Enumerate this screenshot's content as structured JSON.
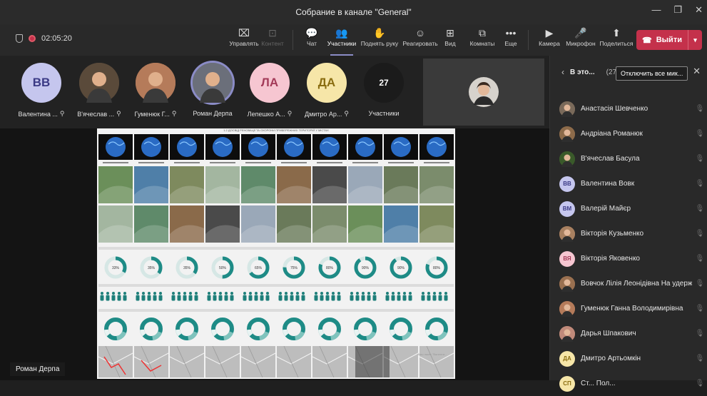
{
  "window": {
    "title": "Собрание в канале \"General\"",
    "controls": [
      "—",
      "❐",
      "✕"
    ]
  },
  "meeting": {
    "elapsed": "02:05:20"
  },
  "toolbar": {
    "items": [
      {
        "label": "Управлять",
        "icon": "share-control-icon",
        "glyph": "⌧",
        "state": "normal"
      },
      {
        "label": "Контент",
        "icon": "content-icon",
        "glyph": "⊡",
        "state": "disabled"
      },
      {
        "label": "Чат",
        "icon": "chat-icon",
        "glyph": "💬",
        "state": "normal"
      },
      {
        "label": "Участники",
        "icon": "participants-icon",
        "glyph": "👥",
        "state": "active"
      },
      {
        "label": "Поднять руку",
        "icon": "raise-hand-icon",
        "glyph": "✋",
        "state": "normal"
      },
      {
        "label": "Реагировать",
        "icon": "react-icon",
        "glyph": "☺",
        "state": "normal"
      },
      {
        "label": "Вид",
        "icon": "view-icon",
        "glyph": "⊞",
        "state": "normal"
      },
      {
        "label": "Комнаты",
        "icon": "rooms-icon",
        "glyph": "⧉",
        "state": "normal"
      },
      {
        "label": "Еще",
        "icon": "more-icon",
        "glyph": "•••",
        "state": "normal"
      },
      {
        "label": "Камера",
        "icon": "camera-off-icon",
        "glyph": "▶",
        "state": "normal"
      },
      {
        "label": "Микрофон",
        "icon": "microphone-icon",
        "glyph": "🎤",
        "state": "normal"
      },
      {
        "label": "Поделиться",
        "icon": "share-icon",
        "glyph": "⬆",
        "state": "normal"
      }
    ],
    "leave_label": "Выйти"
  },
  "strip": {
    "participants": [
      {
        "initials": "ВВ",
        "name": "Валентина ...",
        "bg": "#c5c6ee",
        "fg": "#3b3a85",
        "photo": false
      },
      {
        "initials": "",
        "name": "В'ячеслав ...",
        "bg": "#5a4a3a",
        "fg": "#fff",
        "photo": true
      },
      {
        "initials": "",
        "name": "Гуменюк Г...",
        "bg": "#b57b5a",
        "fg": "#fff",
        "photo": true
      },
      {
        "initials": "",
        "name": "Роман Дерпа",
        "bg": "#6b6f7a",
        "fg": "#fff",
        "photo": true,
        "speaking": true
      },
      {
        "initials": "ЛА",
        "name": "Лепешко А...",
        "bg": "#f6c6d1",
        "fg": "#a33a58",
        "photo": false
      },
      {
        "initials": "ДА",
        "name": "Дмитро Ар...",
        "bg": "#f6e6a8",
        "fg": "#8a6d10",
        "photo": false
      },
      {
        "initials": "27",
        "name": "Участники",
        "bg": "#1b1b1b",
        "fg": "#fff",
        "photo": false,
        "more": true
      }
    ]
  },
  "stage": {
    "presenter": "Роман Дерпа",
    "slide_title": "1.2 ДОСВІД РЕНОВАЦІЇ ТА ОХОРОНИ ПРИБЕРЕЖНИХ ТЕРИТОРІЙ У МІСТАХ",
    "slide_percents": [
      "33%",
      "35%",
      "35%",
      "50%",
      "65%",
      "75%",
      "80%",
      "90%",
      "90%",
      "80%"
    ],
    "watermark": "Ваш пакет \"Валенти..."
  },
  "sidebar": {
    "title": "В это...",
    "count": "(27)",
    "mute_all_label": "Отключить все мик...",
    "participants": [
      {
        "name": "Анастасія Шевченко",
        "initials": "",
        "bg": "#7a6a5a",
        "photo": true
      },
      {
        "name": "Андріана Романюк",
        "initials": "",
        "bg": "#8d6b4a",
        "photo": true
      },
      {
        "name": "В'ячеслав Басула",
        "initials": "",
        "bg": "#3a5a2a",
        "photo": true
      },
      {
        "name": "Валентина Вовк",
        "initials": "ВВ",
        "bg": "#c5c6ee",
        "fg": "#3b3a85",
        "photo": false
      },
      {
        "name": "Валерій Майєр",
        "initials": "ВМ",
        "bg": "#c5c6ee",
        "fg": "#3b3a85",
        "photo": false
      },
      {
        "name": "Вікторія Кузьменко",
        "initials": "",
        "bg": "#a88060",
        "photo": true
      },
      {
        "name": "Вікторія Яковенко",
        "initials": "ВЯ",
        "bg": "#f6c6d1",
        "fg": "#a33a58",
        "photo": false
      },
      {
        "name": "Вовчок Лілія Леонідівна На удержании",
        "initials": "",
        "bg": "#9a7050",
        "photo": true
      },
      {
        "name": "Гуменюк Ганна Володимирівна",
        "initials": "",
        "bg": "#b57b5a",
        "photo": true
      },
      {
        "name": "Дарья Шпакович",
        "initials": "",
        "bg": "#c08a7a",
        "photo": true
      },
      {
        "name": "Дмитро Артьомкін",
        "initials": "ДА",
        "bg": "#f6e6a8",
        "fg": "#8a6d10",
        "photo": false
      },
      {
        "name": "Ст... Пол...",
        "initials": "СП",
        "bg": "#f6e6a8",
        "fg": "#8a6d10",
        "photo": false
      }
    ]
  }
}
